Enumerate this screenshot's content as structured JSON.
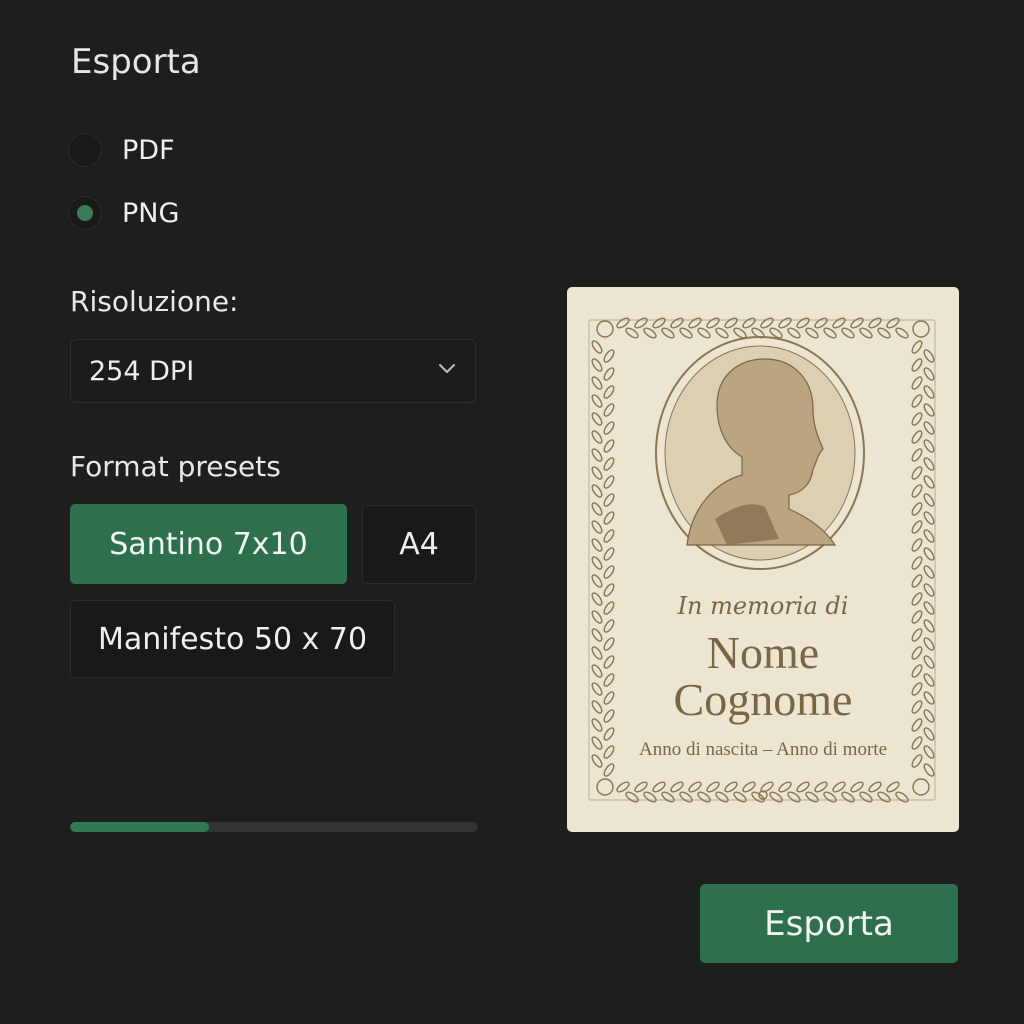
{
  "dialog": {
    "title": "Esporta"
  },
  "format_options": [
    {
      "label": "PDF",
      "selected": false
    },
    {
      "label": "PNG",
      "selected": true
    }
  ],
  "resolution": {
    "label": "Risoluzione:",
    "value": "254 DPI"
  },
  "presets": {
    "label": "Format presets",
    "items": [
      {
        "label": "Santino 7x10",
        "active": true
      },
      {
        "label": "A4",
        "active": false
      },
      {
        "label": "Manifesto 50 x 70",
        "active": false
      }
    ]
  },
  "progress": {
    "fraction": 0.34
  },
  "preview": {
    "line1": "In memoria di",
    "name_line1": "Nome",
    "name_line2": "Cognome",
    "dates": "Anno di nascita – Anno di morte"
  },
  "actions": {
    "export_label": "Esporta"
  },
  "colors": {
    "accent": "#2e6f4e",
    "background": "#1e1e1f",
    "card": "#ece5d2",
    "ink": "#7a6544"
  },
  "icons": {
    "select": "chevron-down-icon"
  }
}
